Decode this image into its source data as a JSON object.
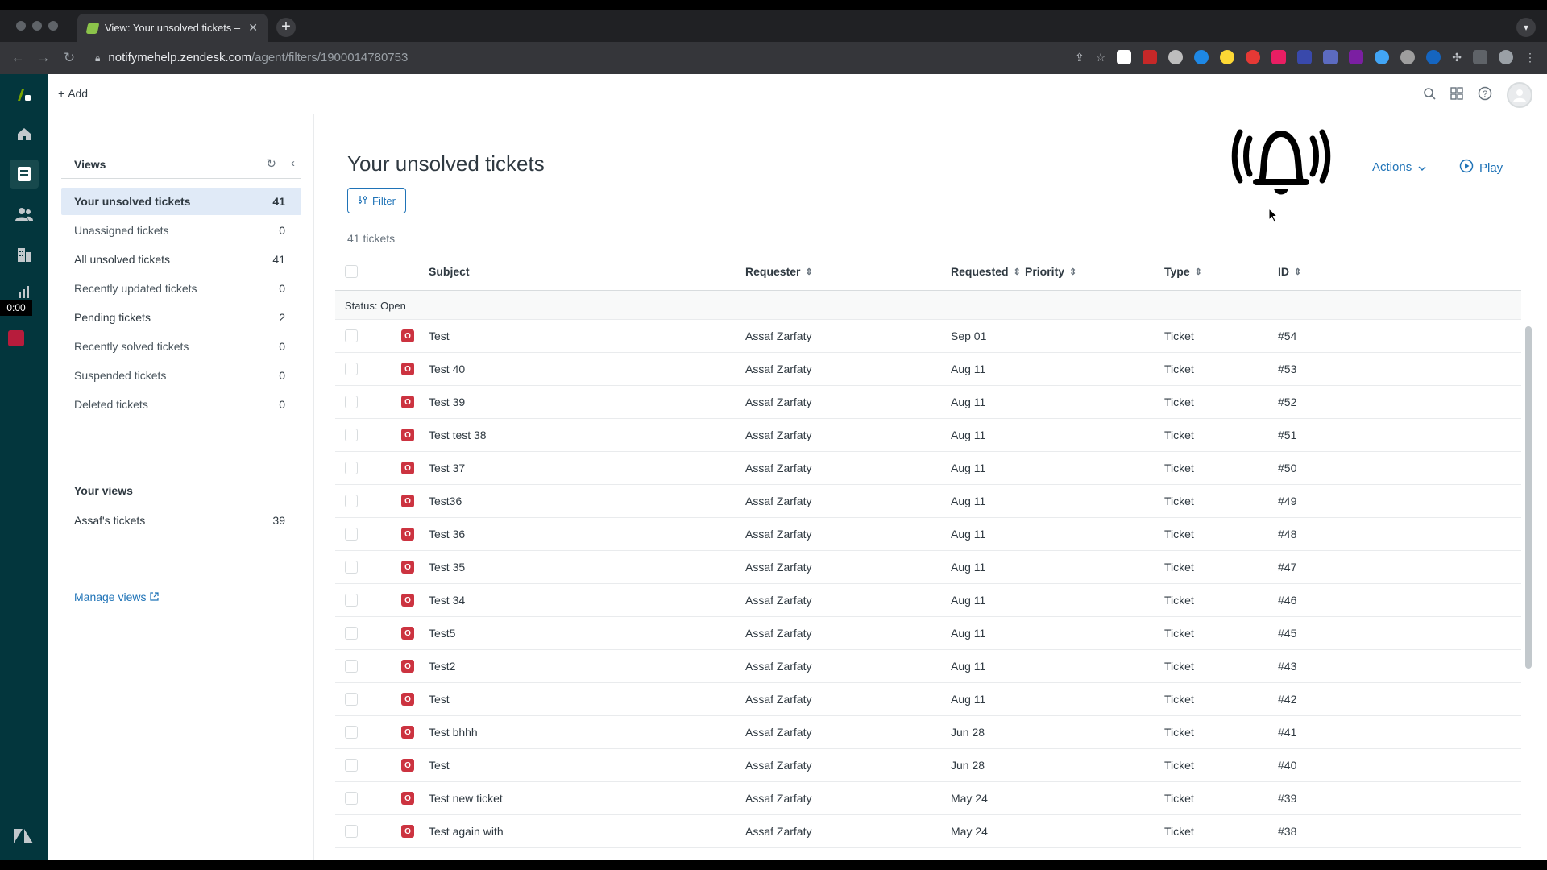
{
  "browser": {
    "tab_title": "View: Your unsolved tickets – r",
    "url_host": "notifymehelp.zendesk.com",
    "url_path": "/agent/filters/1900014780753"
  },
  "rail": {
    "timer": "0:00"
  },
  "topbar": {
    "add_label": "Add"
  },
  "views_panel": {
    "title": "Views",
    "items": [
      {
        "label": "Your unsolved tickets",
        "count": "41"
      },
      {
        "label": "Unassigned tickets",
        "count": "0"
      },
      {
        "label": "All unsolved tickets",
        "count": "41"
      },
      {
        "label": "Recently updated tickets",
        "count": "0"
      },
      {
        "label": "Pending tickets",
        "count": "2"
      },
      {
        "label": "Recently solved tickets",
        "count": "0"
      },
      {
        "label": "Suspended tickets",
        "count": "0"
      },
      {
        "label": "Deleted tickets",
        "count": "0"
      }
    ],
    "your_views_title": "Your views",
    "your_views": [
      {
        "label": "Assaf's tickets",
        "count": "39"
      }
    ],
    "manage_label": "Manage views"
  },
  "main": {
    "title": "Your unsolved tickets",
    "filter_label": "Filter",
    "count_label": "41 tickets",
    "actions_label": "Actions",
    "play_label": "Play",
    "columns": {
      "subject": "Subject",
      "requester": "Requester",
      "requested": "Requested",
      "priority": "Priority",
      "type": "Type",
      "id": "ID"
    },
    "group_label": "Status: Open",
    "status_badge": "O",
    "rows": [
      {
        "subject": "Test",
        "requester": "Assaf Zarfaty",
        "requested": "Sep 01",
        "type": "Ticket",
        "id": "#54"
      },
      {
        "subject": "Test 40",
        "requester": "Assaf Zarfaty",
        "requested": "Aug 11",
        "type": "Ticket",
        "id": "#53"
      },
      {
        "subject": "Test 39",
        "requester": "Assaf Zarfaty",
        "requested": "Aug 11",
        "type": "Ticket",
        "id": "#52"
      },
      {
        "subject": "Test test 38",
        "requester": "Assaf Zarfaty",
        "requested": "Aug 11",
        "type": "Ticket",
        "id": "#51"
      },
      {
        "subject": "Test 37",
        "requester": "Assaf Zarfaty",
        "requested": "Aug 11",
        "type": "Ticket",
        "id": "#50"
      },
      {
        "subject": "Test36",
        "requester": "Assaf Zarfaty",
        "requested": "Aug 11",
        "type": "Ticket",
        "id": "#49"
      },
      {
        "subject": "Test 36",
        "requester": "Assaf Zarfaty",
        "requested": "Aug 11",
        "type": "Ticket",
        "id": "#48"
      },
      {
        "subject": "Test 35",
        "requester": "Assaf Zarfaty",
        "requested": "Aug 11",
        "type": "Ticket",
        "id": "#47"
      },
      {
        "subject": "Test 34",
        "requester": "Assaf Zarfaty",
        "requested": "Aug 11",
        "type": "Ticket",
        "id": "#46"
      },
      {
        "subject": "Test5",
        "requester": "Assaf Zarfaty",
        "requested": "Aug 11",
        "type": "Ticket",
        "id": "#45"
      },
      {
        "subject": "Test2",
        "requester": "Assaf Zarfaty",
        "requested": "Aug 11",
        "type": "Ticket",
        "id": "#43"
      },
      {
        "subject": "Test",
        "requester": "Assaf Zarfaty",
        "requested": "Aug 11",
        "type": "Ticket",
        "id": "#42"
      },
      {
        "subject": "Test bhhh",
        "requester": "Assaf Zarfaty",
        "requested": "Jun 28",
        "type": "Ticket",
        "id": "#41"
      },
      {
        "subject": "Test",
        "requester": "Assaf Zarfaty",
        "requested": "Jun 28",
        "type": "Ticket",
        "id": "#40"
      },
      {
        "subject": "Test new ticket",
        "requester": "Assaf Zarfaty",
        "requested": "May 24",
        "type": "Ticket",
        "id": "#39"
      },
      {
        "subject": "Test again with",
        "requester": "Assaf Zarfaty",
        "requested": "May 24",
        "type": "Ticket",
        "id": "#38"
      }
    ]
  },
  "colors": {
    "rail": "#03363d",
    "accent": "#1f73b7",
    "open_badge": "#cc3340",
    "active_view": "#e0eaf7"
  }
}
